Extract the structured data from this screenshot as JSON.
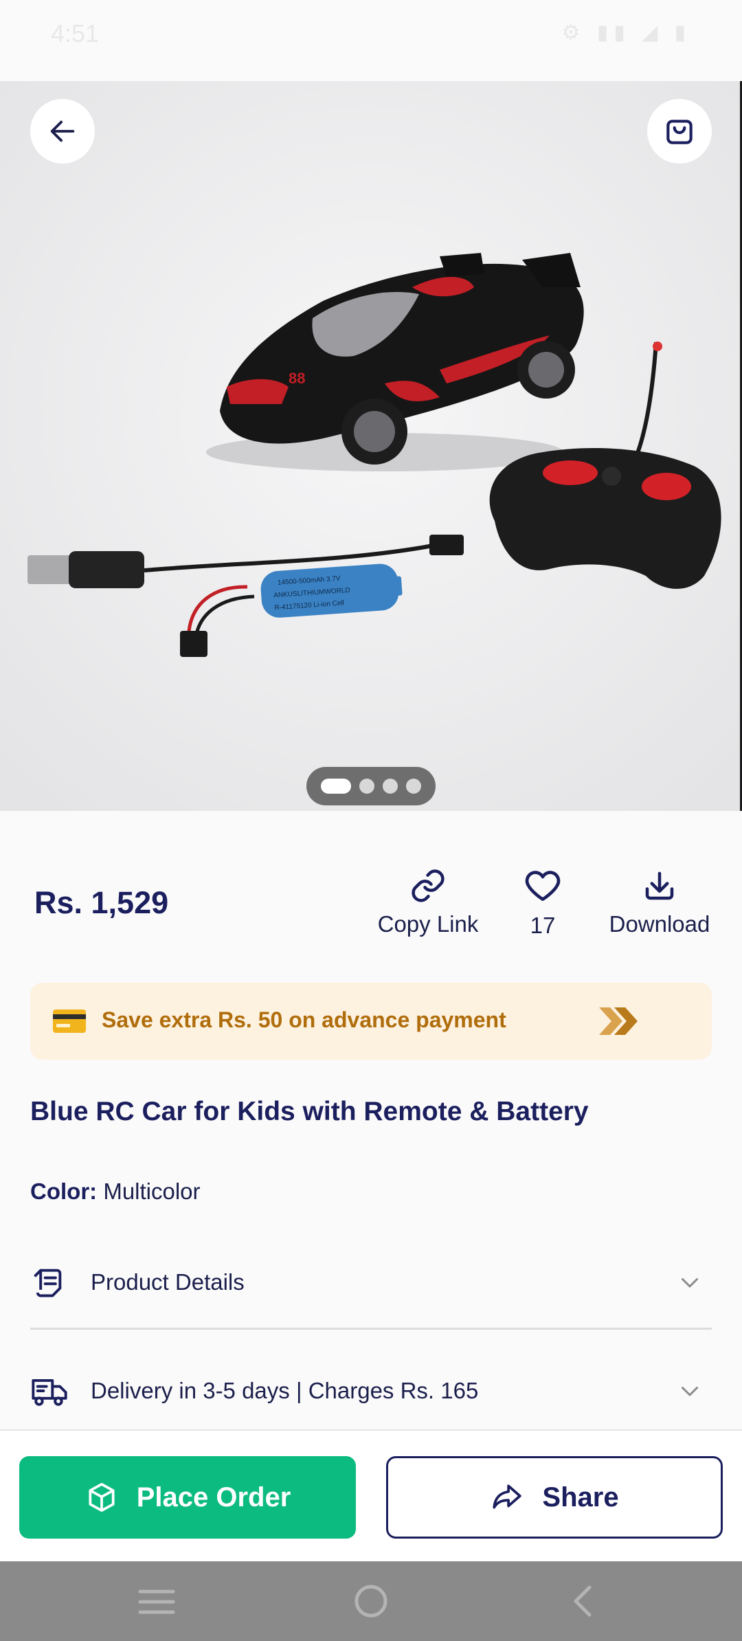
{
  "status_bar": {
    "time": "4:51",
    "icons": "⚙  ▮▮  ◢  ▮"
  },
  "product": {
    "price": "Rs. 1,529",
    "title": "Blue RC Car for Kids with Remote & Battery",
    "color_label": "Color:",
    "color_value": "Multicolor",
    "battery_label_line1": "14500-500mAh 3.7V",
    "battery_label_line2": "ANKUSLITHIUMWORLD",
    "battery_label_line3": "R-41175120 Li-ion Cell",
    "car_number": "88"
  },
  "carousel": {
    "total": 4,
    "active_index": 0
  },
  "actions": {
    "copy_link": "Copy Link",
    "likes": "17",
    "download": "Download"
  },
  "promo": {
    "text": "Save extra Rs. 50 on advance payment"
  },
  "accordions": {
    "details": "Product Details",
    "delivery": "Delivery in 3-5 days | Charges Rs. 165"
  },
  "buttons": {
    "place_order": "Place Order",
    "share": "Share"
  },
  "colors": {
    "primary": "#0cbb7f",
    "navy": "#1b1f5e",
    "promo_bg": "#fdf1df",
    "promo_text": "#b06d0c"
  }
}
